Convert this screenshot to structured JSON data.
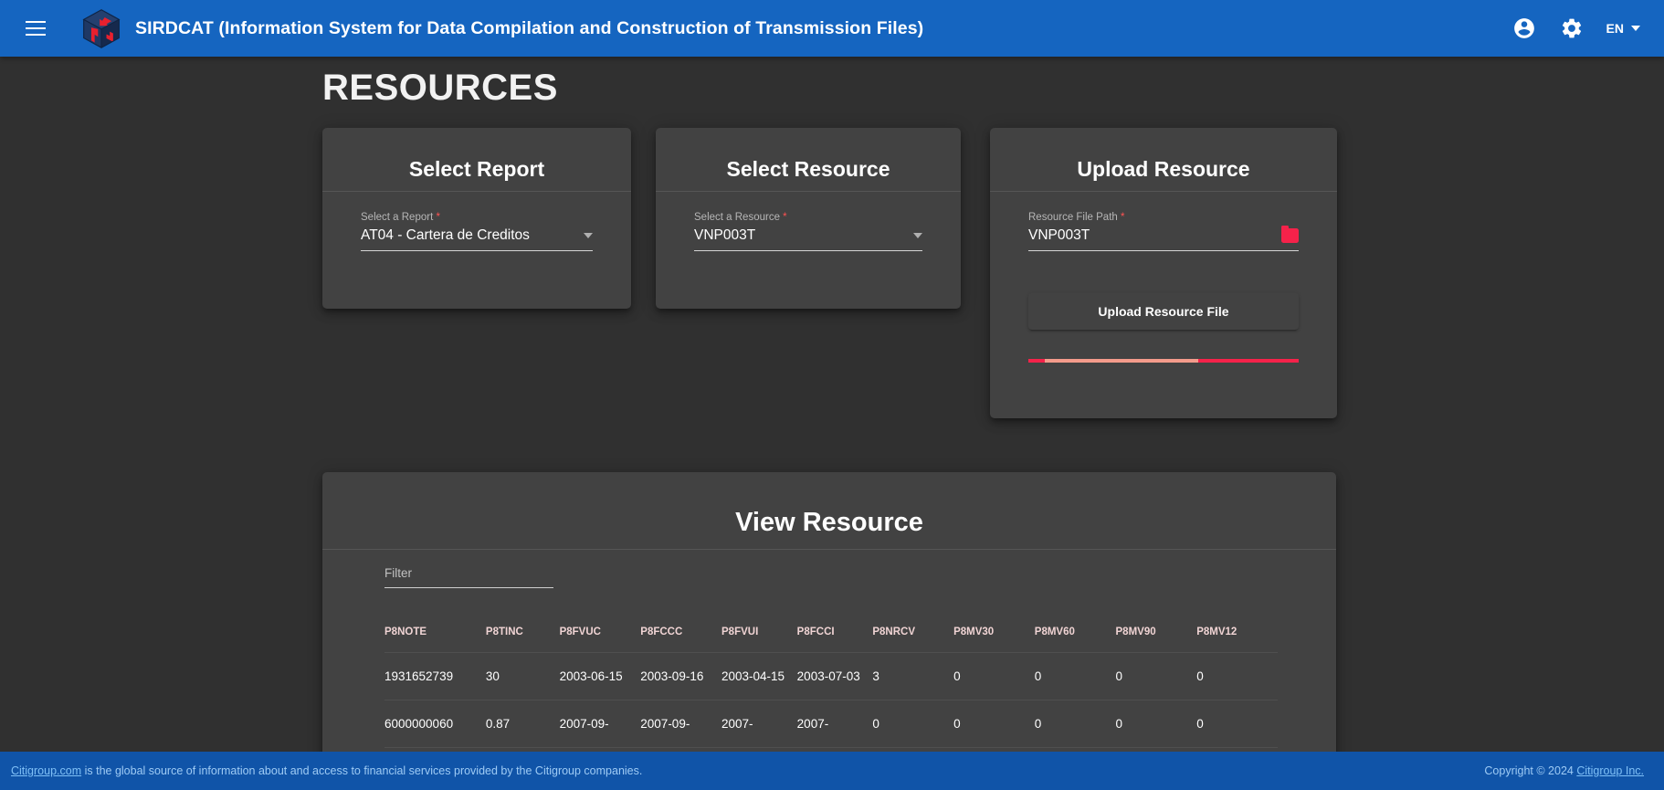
{
  "header": {
    "menu_icon": "hamburger-menu-icon",
    "logo_icon": "sirdcat-cube-logo",
    "title": "SIRDCAT (Information System for Data Compilation and Construction of Transmission Files)",
    "account_icon": "account-circle-icon",
    "settings_icon": "gear-icon",
    "language": "EN",
    "language_caret": "chevron-down-icon",
    "background_color": "#1565C0"
  },
  "page": {
    "title": "RESOURCES",
    "background_color": "#303030"
  },
  "cards": {
    "select_report": {
      "title": "Select Report",
      "field_label": "Select a Report",
      "required_marker": "*",
      "value": "AT04 - Cartera de Creditos",
      "dropdown_icon": "chevron-down-icon"
    },
    "select_resource": {
      "title": "Select Resource",
      "field_label": "Select a Resource",
      "required_marker": "*",
      "value": "VNP003T",
      "dropdown_icon": "chevron-down-icon"
    },
    "upload_resource": {
      "title": "Upload Resource",
      "field_label": "Resource File Path",
      "required_marker": "*",
      "value": "VNP003T",
      "browse_icon": "folder-icon",
      "browse_icon_color": "#f5224a",
      "button_label": "Upload Resource File",
      "progress": {
        "buffer_color": "#f5224a",
        "track_color": "#f49b8b"
      }
    }
  },
  "view_resource": {
    "title": "View Resource",
    "filter_label": "Filter",
    "filter_value": "",
    "table": {
      "columns": [
        "P8NOTE",
        "P8TINC",
        "P8FVUC",
        "P8FCCC",
        "P8FVUI",
        "P8FCCI",
        "P8NRCV",
        "P8MV30",
        "P8MV60",
        "P8MV90",
        "P8MV12"
      ],
      "rows": [
        [
          "1931652739",
          "30",
          "2003-06-15",
          "2003-09-16",
          "2003-04-15",
          "2003-07-03",
          "3",
          "0",
          "0",
          "0",
          "0"
        ],
        [
          "6000000060",
          "0.87",
          "2007-09-",
          "2007-09-",
          "2007-",
          "2007-",
          "0",
          "0",
          "0",
          "0",
          "0"
        ]
      ]
    }
  },
  "footer": {
    "link_text": "Citigroup.com",
    "text": " is the global source of information about and access to financial services provided by the Citigroup companies.",
    "copyright_prefix": "Copyright © 2024 ",
    "copyright_link": "Citigroup Inc.",
    "background_color": "#1054A8"
  }
}
